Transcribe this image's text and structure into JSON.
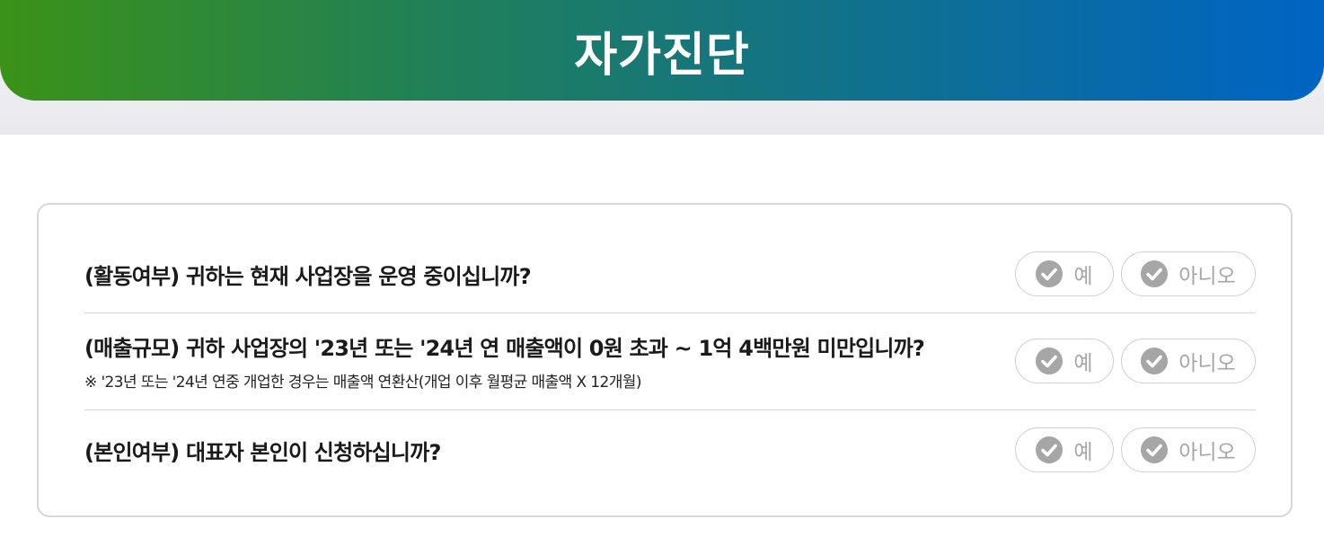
{
  "header": {
    "title": "자가진단"
  },
  "questions": [
    {
      "text": "(활동여부) 귀하는 현재 사업장을 운영 중이십니까?",
      "note": "",
      "yes_label": "예",
      "no_label": "아니오"
    },
    {
      "text": "(매출규모) 귀하 사업장의 '23년 또는 '24년 연 매출액이 0원 초과 ~ 1억 4백만원 미만입니까?",
      "note": "※ '23년 또는 '24년 연중 개업한 경우는 매출액 연환산(개업 이후 월평균 매출액 X 12개월)",
      "yes_label": "예",
      "no_label": "아니오"
    },
    {
      "text": "(본인여부) 대표자 본인이 신청하십니까?",
      "note": "",
      "yes_label": "예",
      "no_label": "아니오"
    }
  ],
  "colors": {
    "gradient_start": "#3b9218",
    "gradient_end": "#0064c4",
    "button_inactive": "#a6a6a6"
  },
  "icons": {
    "option_check": "check-circle-icon"
  }
}
